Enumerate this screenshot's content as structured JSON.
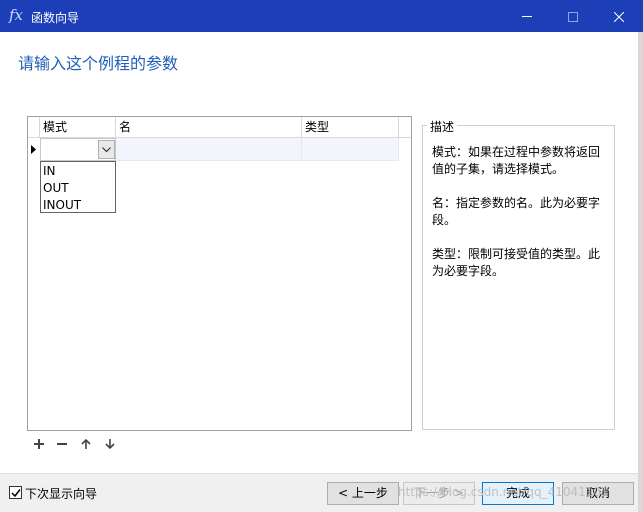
{
  "window": {
    "title": "函数向导",
    "fx_glyph": "fx"
  },
  "heading": "请输入这个例程的参数",
  "table": {
    "columns": [
      "模式",
      "名",
      "类型"
    ],
    "current_row": {
      "mode": "",
      "name": "",
      "type": ""
    },
    "mode_options": [
      "IN",
      "OUT",
      "INOUT"
    ]
  },
  "toolbar": {
    "icons": [
      "add-icon",
      "remove-icon",
      "move-up-icon",
      "move-down-icon"
    ]
  },
  "description": {
    "title": "描述",
    "paragraphs": [
      "模式：如果在过程中参数将返回值的子集，请选择模式。",
      "名：指定参数的名。此为必要字段。",
      "类型：限制可接受值的类型。此为必要字段。"
    ]
  },
  "footer": {
    "checkbox_label": "下次显示向导",
    "checkbox_checked": true,
    "prev_label": "< 上一步",
    "next_label": "下一步 >",
    "finish_label": "完成",
    "cancel_label": "取消"
  },
  "watermark": "https://blog.csdn.net/qq_41041101",
  "colors": {
    "titlebar": "#1c3fb7",
    "heading": "#1f5fb8",
    "finish_border": "#0078d7"
  }
}
